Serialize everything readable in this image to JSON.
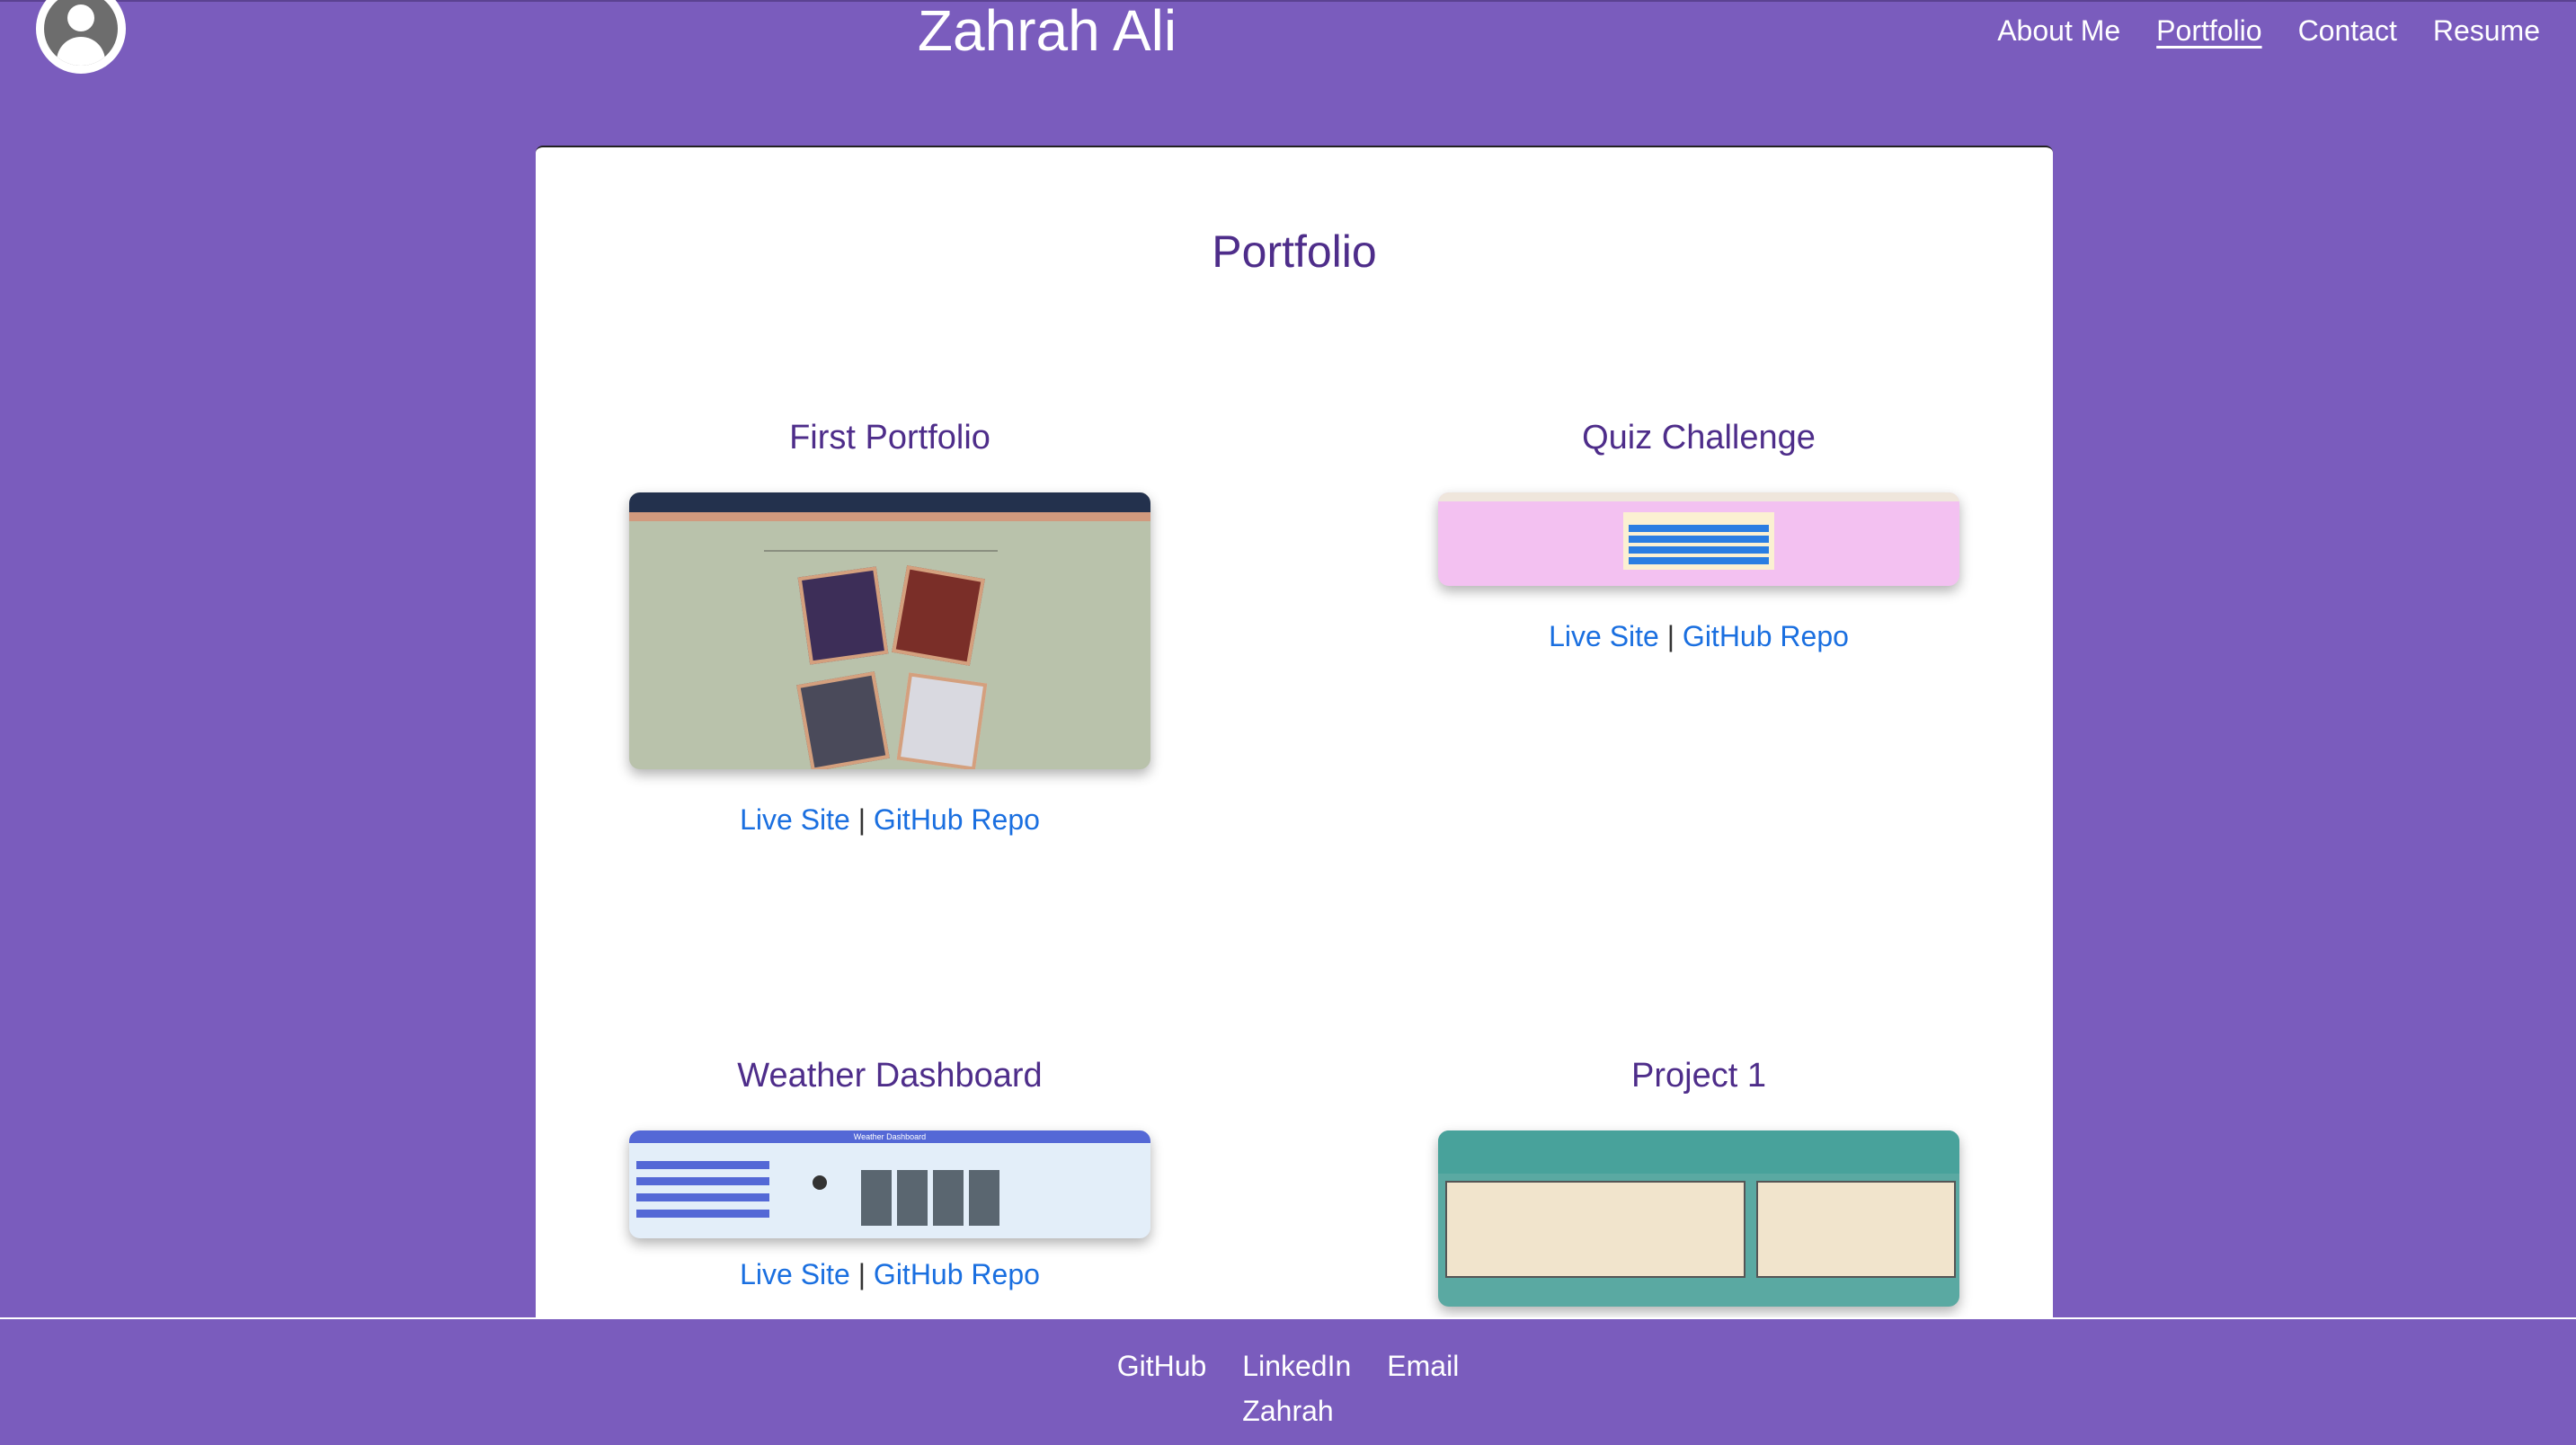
{
  "header": {
    "site_title": "Zahrah Ali",
    "nav": [
      "About Me",
      "Portfolio",
      "Contact",
      "Resume"
    ],
    "active_nav": "Portfolio"
  },
  "main": {
    "title": "Portfolio",
    "projects": [
      {
        "title": "First Portfolio",
        "live_label": "Live Site",
        "separator": "|",
        "repo_label": "GitHub Repo"
      },
      {
        "title": "Quiz Challenge",
        "live_label": "Live Site",
        "separator": "|",
        "repo_label": "GitHub Repo"
      },
      {
        "title": "Weather Dashboard",
        "live_label": "Live Site",
        "separator": "|",
        "repo_label": "GitHub Repo",
        "thumb_header": "Weather Dashboard"
      },
      {
        "title": "Project 1"
      }
    ]
  },
  "footer": {
    "links": [
      "GitHub",
      "LinkedIn",
      "Email"
    ],
    "name": "Zahrah"
  },
  "colors": {
    "background": "#7a5cbd",
    "heading": "#4e2d8a",
    "link": "#1a6fe0"
  }
}
